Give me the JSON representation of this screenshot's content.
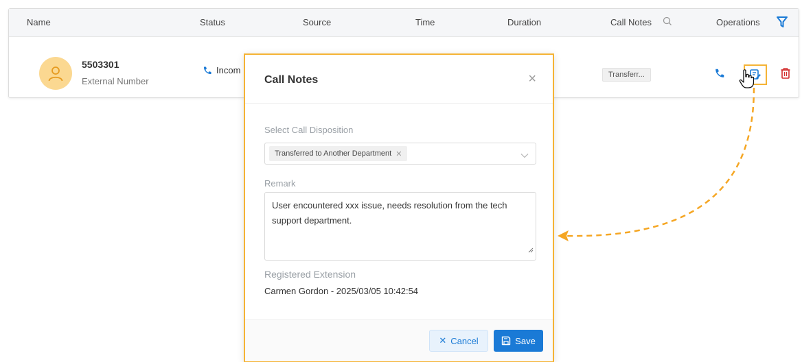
{
  "table": {
    "columns": [
      "Name",
      "Status",
      "Source",
      "Time",
      "Duration",
      "Call Notes",
      "Operations"
    ],
    "row": {
      "number": "5503301",
      "type": "External Number",
      "status": "Incom",
      "call_notes_tag": "Transferr..."
    }
  },
  "modal": {
    "title": "Call Notes",
    "close": "×",
    "disposition_label": "Select Call Disposition",
    "disposition_selected": "Transferred to Another Department",
    "remark_label": "Remark",
    "remark_value": "User encountered xxx issue, needs resolution from the tech support department.",
    "registered_label": "Registered Extension",
    "registered_value": "Carmen Gordon - 2025/03/05 10:42:54",
    "cancel_label": "Cancel",
    "save_label": "Save"
  },
  "colors": {
    "accent": "#1a7ad6",
    "highlight": "#f5b335",
    "delete": "#d32f2f",
    "avatar_bg": "#fbd891"
  }
}
